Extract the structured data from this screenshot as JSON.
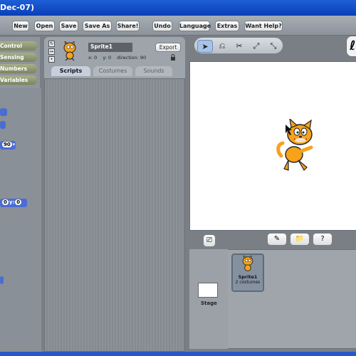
{
  "window": {
    "title": "Dec-07)"
  },
  "menu": {
    "new": "New",
    "open": "Open",
    "save": "Save",
    "save_as": "Save As",
    "share": "Share!",
    "undo": "Undo",
    "language": "Language",
    "extras": "Extras",
    "help": "Want Help?"
  },
  "categories": [
    "Control",
    "Sensing",
    "Numbers",
    "Variables"
  ],
  "palette": {
    "block_90": "90",
    "block_x": "0",
    "block_y_label": "y:",
    "block_y": "0"
  },
  "sprite": {
    "name": "Sprite1",
    "x_label": "x: 0",
    "y_label": "y: 0",
    "direction_label": "direction: 90",
    "export": "Export"
  },
  "tabs": [
    "Scripts",
    "Costumes",
    "Sounds"
  ],
  "library": {
    "stage_label": "Stage",
    "sprite_name": "Sprite1",
    "sprite_costumes": "2 costumes"
  },
  "colors": {
    "accent_blue": "#0a3fb8",
    "block_blue": "#4a6cd4",
    "cat_orange": "#f7a21b"
  }
}
